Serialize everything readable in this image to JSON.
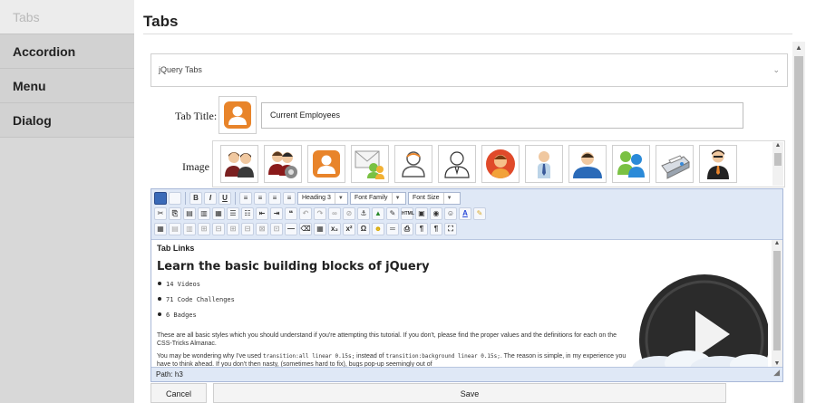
{
  "sidebar": {
    "items": [
      {
        "label": "Tabs",
        "active": true
      },
      {
        "label": "Accordion",
        "active": false
      },
      {
        "label": "Menu",
        "active": false
      },
      {
        "label": "Dialog",
        "active": false
      }
    ]
  },
  "header": {
    "title": "Tabs"
  },
  "form": {
    "select_value": "jQuery Tabs",
    "tab_title_label": "Tab Title:",
    "tab_title_value": "Current Employees",
    "image_label": "Image :",
    "image_options": [
      "two-users-icon",
      "users-settings-icon",
      "user-orange-icon",
      "users-mail-icon",
      "user-outline-icon",
      "user-outline-2-icon",
      "user-red-circle-icon",
      "user-tie-icon",
      "user-blue-icon",
      "messenger-users-icon",
      "fax-icon",
      "businessman-icon"
    ]
  },
  "editor": {
    "toolbar": {
      "format_value": "Heading 3",
      "font_family_value": "Font Family",
      "font_size_value": "Font Size"
    },
    "content": {
      "heading": "Tab Links",
      "title": "Learn the basic building blocks of jQuery",
      "bullets": [
        "14 Videos",
        "71 Code Challenges",
        "6 Badges"
      ],
      "para1": "These are all basic styles which you should understand if you're attempting this tutorial. If you don't, please find the proper values and the definitions for each on the CSS-Tricks Almanac.",
      "para2_a": "You may be wondering why I've used ",
      "para2_code1": "transition:all linear 0.15s;",
      "para2_b": " instead of ",
      "para2_code2": "transition:background linear 0.15s;",
      "para2_c": ". The reason is simple, in my experience you have to think ahead. If you don't then nasty, (sometimes hard to fix), bugs pop-up seemingly out of"
    },
    "status_path": "Path: h3"
  },
  "actions": {
    "cancel_label": "Cancel",
    "save_label": "Save"
  },
  "colors": {
    "accent_orange": "#e8842a",
    "toolbar_bg": "#dfe8f6",
    "sidebar_bg": "#d2d2d2"
  }
}
